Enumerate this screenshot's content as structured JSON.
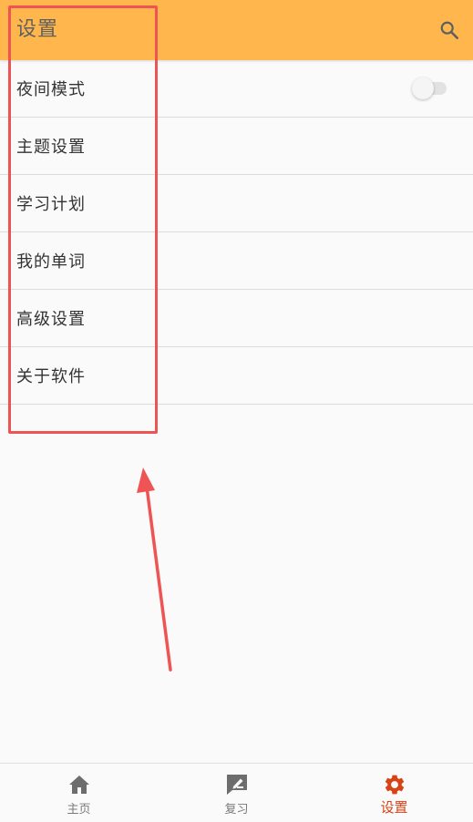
{
  "appbar": {
    "title": "设置",
    "search_icon": "search-icon",
    "background_color": "#ffb74d"
  },
  "settings": {
    "items": [
      {
        "label": "夜间模式",
        "has_toggle": true,
        "toggle_on": false
      },
      {
        "label": "主题设置"
      },
      {
        "label": "学习计划"
      },
      {
        "label": "我的单词"
      },
      {
        "label": "高级设置"
      },
      {
        "label": "关于软件"
      }
    ]
  },
  "bottom_nav": {
    "items": [
      {
        "label": "主页",
        "icon": "home-icon",
        "active": false
      },
      {
        "label": "复习",
        "icon": "review-icon",
        "active": false
      },
      {
        "label": "设置",
        "icon": "gear-icon",
        "active": true
      }
    ],
    "active_color": "#d84315",
    "inactive_color": "#7a7a7a"
  },
  "annotation": {
    "color": "#ef5454"
  }
}
